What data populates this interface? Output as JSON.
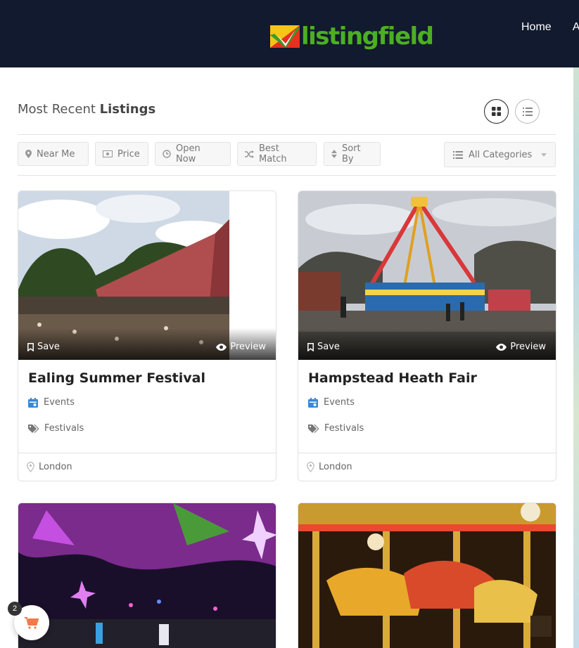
{
  "header": {
    "logo_text": "listingfield",
    "nav": [
      "Home",
      "A"
    ]
  },
  "listing_header": {
    "title_prefix": "Most Recent",
    "title_strong": "Listings"
  },
  "filters": {
    "near_me": "Near Me",
    "price": "Price",
    "open_now": "Open Now",
    "best_match": "Best Match",
    "sort_by": "Sort By",
    "categories": "All Categories"
  },
  "cards": [
    {
      "title": "Ealing Summer Festival",
      "category": "Events",
      "tag": "Festivals",
      "location": "London",
      "save": "Save",
      "preview": "Preview"
    },
    {
      "title": "Hampstead Heath Fair",
      "category": "Events",
      "tag": "Festivals",
      "location": "London",
      "save": "Save",
      "preview": "Preview"
    }
  ],
  "cart": {
    "count": "2"
  },
  "colors": {
    "header_bg": "#111a2e",
    "logo_green": "#4caf22",
    "category_blue": "#3a86d8"
  }
}
